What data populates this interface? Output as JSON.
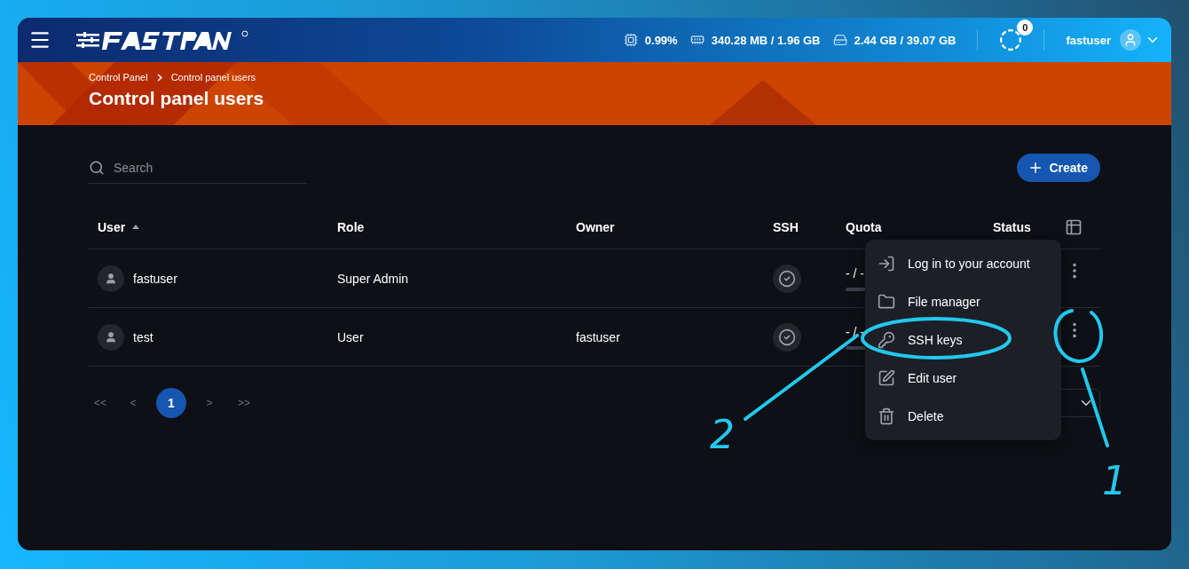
{
  "header": {
    "stats": [
      {
        "kind": "cpu",
        "value": "0.99%"
      },
      {
        "kind": "ram",
        "value": "340.28 MB / 1.96 GB"
      },
      {
        "kind": "disk",
        "value": "2.44 GB / 39.07 GB"
      }
    ],
    "tasks_count": "0",
    "username": "fastuser"
  },
  "banner": {
    "breadcrumb": [
      "Control Panel",
      "Control panel users"
    ],
    "title": "Control panel users"
  },
  "search": {
    "placeholder": "Search"
  },
  "create_button": "Create",
  "table": {
    "columns": [
      {
        "label": "User",
        "sorted": true
      },
      {
        "label": "Role",
        "sorted": false
      },
      {
        "label": "Owner",
        "sorted": false
      },
      {
        "label": "SSH",
        "sorted": false
      },
      {
        "label": "Quota",
        "sorted": false
      },
      {
        "label": "Status",
        "sorted": false
      }
    ],
    "rows": [
      {
        "user": "fastuser",
        "role": "Super Admin",
        "owner": "",
        "ssh": true,
        "quota": "- / -"
      },
      {
        "user": "test",
        "role": "User",
        "owner": "fastuser",
        "ssh": true,
        "quota": "- / -"
      }
    ]
  },
  "pagination": [
    {
      "label": "<<",
      "selected": false
    },
    {
      "label": "<",
      "selected": false
    },
    {
      "label": "1",
      "selected": true
    },
    {
      "label": ">",
      "selected": false
    },
    {
      "label": ">>",
      "selected": false
    }
  ],
  "context_menu": [
    {
      "kind": "login",
      "label": "Log in to your account"
    },
    {
      "kind": "files",
      "label": "File manager"
    },
    {
      "kind": "key",
      "label": "SSH keys"
    },
    {
      "kind": "edit",
      "label": "Edit user"
    },
    {
      "kind": "delete",
      "label": "Delete"
    }
  ],
  "annotations": [
    {
      "label": "1"
    },
    {
      "label": "2"
    }
  ]
}
